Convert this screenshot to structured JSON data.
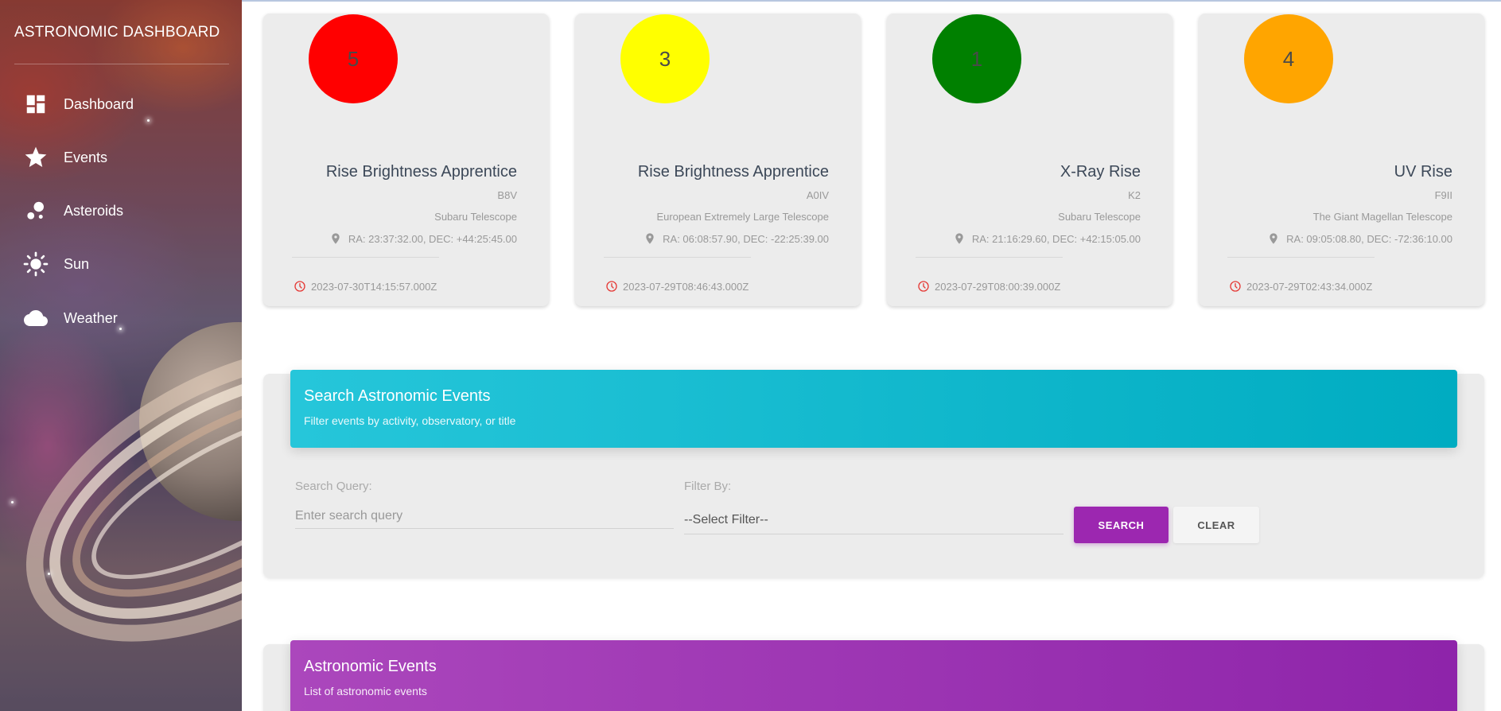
{
  "sidebar": {
    "brand": "ASTRONOMIC DASHBOARD",
    "items": [
      {
        "label": "Dashboard",
        "icon": "dashboard-icon"
      },
      {
        "label": "Events",
        "icon": "star-icon"
      },
      {
        "label": "Asteroids",
        "icon": "asteroids-icon"
      },
      {
        "label": "Sun",
        "icon": "sun-icon"
      },
      {
        "label": "Weather",
        "icon": "cloud-icon"
      }
    ]
  },
  "cards": [
    {
      "count": "5",
      "color": "#ff0000",
      "title": "Rise Brightness Apprentice",
      "spectral": "B8V",
      "observatory": "Subaru Telescope",
      "coords": "RA: 23:37:32.00, DEC: +44:25:45.00",
      "time": "2023-07-30T14:15:57.000Z"
    },
    {
      "count": "3",
      "color": "#ffff00",
      "title": "Rise Brightness Apprentice",
      "spectral": "A0IV",
      "observatory": "European Extremely Large Telescope",
      "coords": "RA: 06:08:57.90, DEC: -22:25:39.00",
      "time": "2023-07-29T08:46:43.000Z"
    },
    {
      "count": "1",
      "color": "#008000",
      "title": "X-Ray Rise",
      "spectral": "K2",
      "observatory": "Subaru Telescope",
      "coords": "RA: 21:16:29.60, DEC: +42:15:05.00",
      "time": "2023-07-29T08:00:39.000Z"
    },
    {
      "count": "4",
      "color": "#ffa500",
      "title": "UV Rise",
      "spectral": "F9II",
      "observatory": "The Giant Magellan Telescope",
      "coords": "RA: 09:05:08.80, DEC: -72:36:10.00",
      "time": "2023-07-29T02:43:34.000Z"
    }
  ],
  "search": {
    "title": "Search Astronomic Events",
    "subtitle": "Filter events by activity, observatory, or title",
    "query_label": "Search Query:",
    "query_placeholder": "Enter search query",
    "query_value": "",
    "filter_label": "Filter By:",
    "filter_selected": "--Select Filter--",
    "search_button": "SEARCH",
    "clear_button": "CLEAR",
    "header_color": "#00acc1",
    "button_color": "#9c27b0"
  },
  "events_panel": {
    "title": "Astronomic Events",
    "subtitle": "List of astronomic events",
    "header_color": "#8e24aa"
  }
}
